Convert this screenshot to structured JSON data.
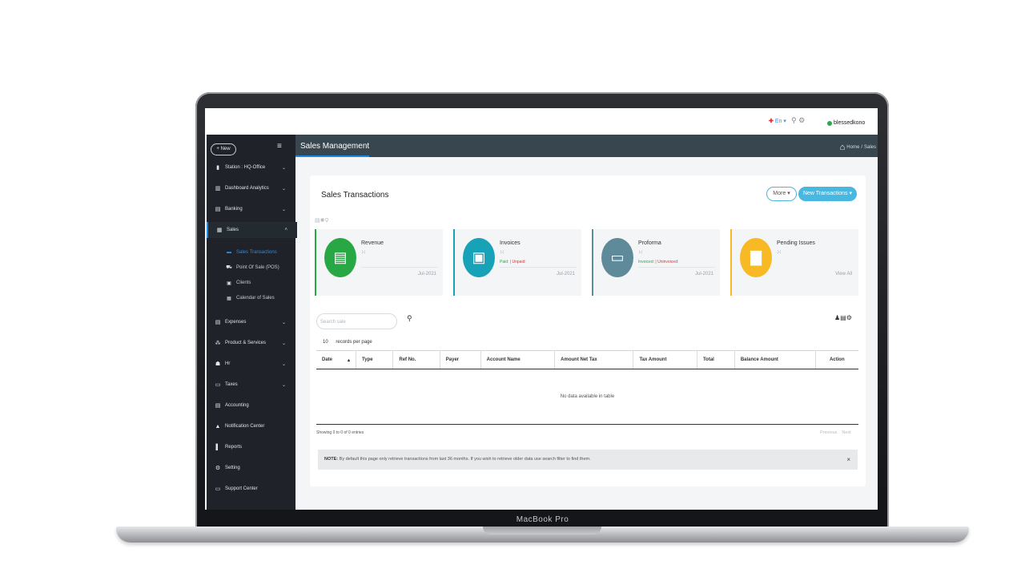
{
  "device": {
    "label": "MacBook Pro"
  },
  "topbar": {
    "flag_icon": "plus-flag-icon",
    "lang": "En",
    "icons": [
      "search-icon",
      "gear-icon"
    ],
    "user": "blessedkono"
  },
  "sidebar": {
    "new_button": "+ New",
    "menu_icon": "hamburger-icon",
    "items": [
      {
        "label": "Station : HQ-Office",
        "icon": "building-icon"
      },
      {
        "label": "Dashboard Analytics",
        "icon": "chart-icon"
      },
      {
        "label": "Banking",
        "icon": "bank-card-icon"
      },
      {
        "label": "Sales",
        "icon": "sales-icon"
      },
      {
        "label": "Expenses",
        "icon": "receipt-icon"
      },
      {
        "label": "Product & Services",
        "icon": "box-icon"
      },
      {
        "label": "Hr",
        "icon": "users-icon"
      },
      {
        "label": "Taxes",
        "icon": "tax-icon"
      },
      {
        "label": "Accounting",
        "icon": "ledger-icon"
      },
      {
        "label": "Notification Center",
        "icon": "bell-icon"
      },
      {
        "label": "Reports",
        "icon": "file-icon"
      },
      {
        "label": "Setting",
        "icon": "gears-icon"
      },
      {
        "label": "Support Center",
        "icon": "support-icon"
      }
    ],
    "sales_sub": [
      {
        "label": "Sales Transactions",
        "icon": "money-icon"
      },
      {
        "label": "Point Of Sale (POS)",
        "icon": "cart-icon"
      },
      {
        "label": "Clients",
        "icon": "id-card-icon"
      },
      {
        "label": "Calendar of Sales",
        "icon": "calendar-icon"
      }
    ]
  },
  "header": {
    "title": "Sales Management",
    "breadcrumb": [
      "Home",
      "/",
      "Sales"
    ]
  },
  "page": {
    "title": "Sales Transactions",
    "more_button": "More",
    "new_button": "New Transactions",
    "search_placeholder": "Search sale",
    "page_size": "10",
    "records_label": "records per page",
    "stats": [
      {
        "name": "Revenue",
        "date": "Jul-2021",
        "color": "#27a844",
        "icon": "cash-icon"
      },
      {
        "name": "Invoices",
        "paid": "Paid:",
        "unpaid": "Unpaid:",
        "date": "Jul-2021",
        "color": "#17a2b8",
        "icon": "banknote-icon"
      },
      {
        "name": "Proforma",
        "invoiced": "Invoiced:",
        "uninvoiced": "Uninvoiced:",
        "date": "Jul-2021",
        "color": "#5e8a99",
        "icon": "card-icon"
      },
      {
        "name": "Pending Issues",
        "link": "View All",
        "color": "#f7b924",
        "icon": "note-icon"
      }
    ],
    "table": {
      "columns": [
        "Date",
        "Type",
        "Ref No.",
        "Payer",
        "Account Name",
        "Amount Net Tax",
        "Tax Amount",
        "Total",
        "Balance Amount",
        "Action"
      ],
      "empty": "No data available in table"
    },
    "showing": "Showing 0 to 0 of 0 entries",
    "pager": {
      "prev": "Previous",
      "next": "Next"
    },
    "note_label": "NOTE:",
    "note_text": "By default this page only retrieve transactions from last 36 months. If you wish to retrieve older data use search filter to find them."
  }
}
